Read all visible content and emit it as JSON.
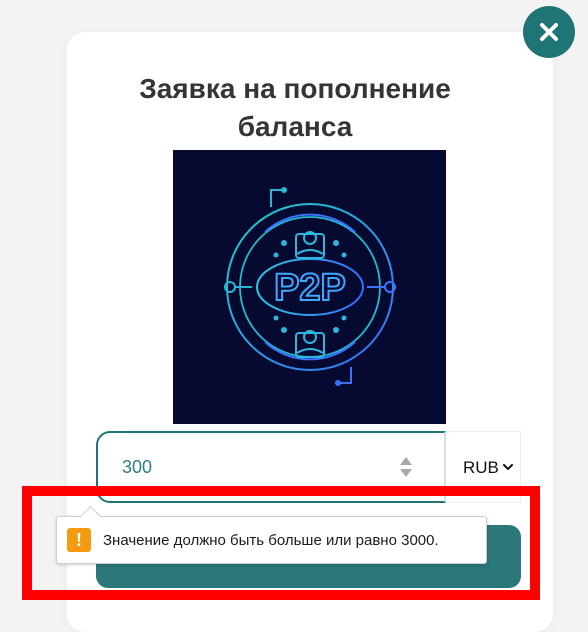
{
  "modal": {
    "title": "Заявка на пополнение баланса",
    "close_icon": "close-icon"
  },
  "logo": {
    "text": "P2P",
    "icon": "p2p-logo-icon",
    "colors": {
      "background": "#060a31",
      "line_primary": "#26b5cf",
      "line_secondary": "#3d6bff"
    }
  },
  "amount": {
    "value": "300",
    "stepper_icon": "number-stepper-icon"
  },
  "currency": {
    "selected": "RUB",
    "icon": "chevron-down-icon"
  },
  "validation": {
    "icon": "warning-icon",
    "icon_symbol": "!",
    "message": "Значение должно быть больше или равно 3000."
  },
  "colors": {
    "page_background": "#f3f3f4",
    "accent": "#2c7779",
    "highlight": "#ff0000"
  }
}
